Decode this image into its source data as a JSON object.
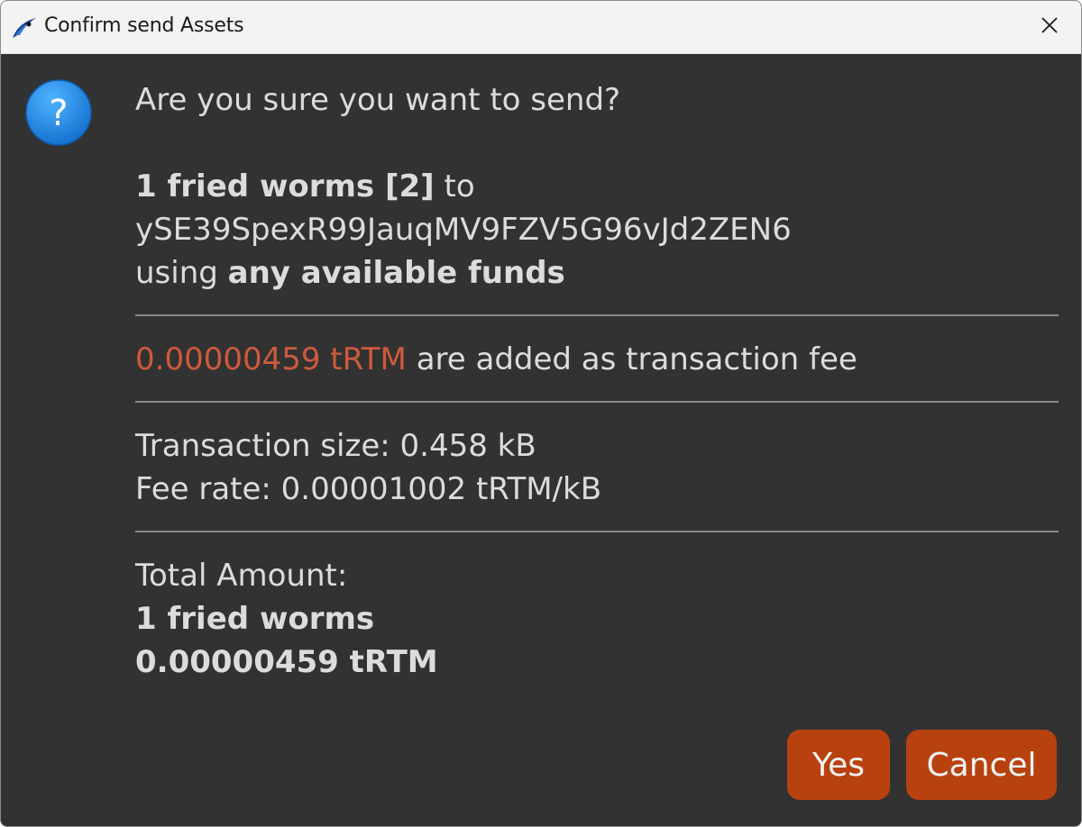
{
  "window": {
    "title": "Confirm send Assets",
    "close_symbol": "✕"
  },
  "icons": {
    "app": "raptoreum-app-icon",
    "question": "question-icon",
    "close": "close-icon"
  },
  "dialog": {
    "question": "Are you sure you want to send?",
    "asset_amount": "1 fried worms [2]",
    "to_word": " to",
    "address": "ySE39SpexR99JauqMV9FZV5G96vJd2ZEN6",
    "using_word": "using ",
    "funds_source": "any available funds",
    "fee_amount": "0.00000459 tRTM",
    "fee_text": " are added as transaction fee",
    "tx_size": "Transaction size: 0.458 kB",
    "fee_rate": "Fee rate: 0.00001002 tRTM/kB",
    "total_label": "Total Amount:",
    "total_asset": "1 fried worms",
    "total_coin": "0.00000459 tRTM"
  },
  "buttons": {
    "yes": "Yes",
    "cancel": "Cancel"
  },
  "colors": {
    "background": "#323232",
    "text": "#dcdcdc",
    "fee_highlight": "#cf5a3c",
    "button": "#b8420f",
    "titlebar": "#f3f3f3",
    "question_icon": "#1e90e6"
  }
}
